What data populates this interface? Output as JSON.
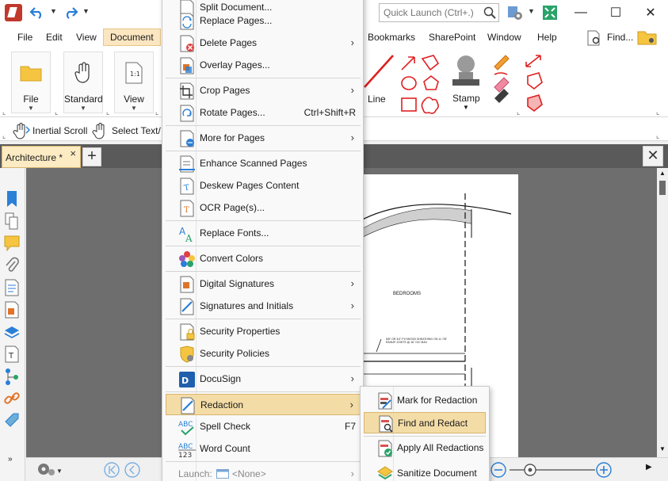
{
  "titlebar": {
    "search_placeholder": "Quick Launch (Ctrl+.)"
  },
  "menubar": {
    "items": [
      "File",
      "Edit",
      "View",
      "Document",
      "Bookmarks",
      "SharePoint",
      "Window",
      "Help"
    ],
    "find_label": "Find..."
  },
  "ribbon": {
    "file_label": "File",
    "standard_label": "Standard",
    "view_label": "View",
    "line_label": "Line",
    "stamp_label": "Stamp"
  },
  "toolbar2": {
    "inertial_scroll": "Inertial Scroll",
    "select_text": "Select Text/"
  },
  "tabs": {
    "document_tab": "Architecture *",
    "close_glyph": "×",
    "add_glyph": "+"
  },
  "page": {
    "label_bedrooms": "BEDROOMS",
    "label_note": "5/8\" OR 3/4\" PLYWOOD SHEATHING ON 11 7/8\" RAINJP JOISTS @ 16\" O/C MAX"
  },
  "document_menu": {
    "top_partial": "Split Document...",
    "items": [
      {
        "label": "Replace Pages...",
        "arrow": false,
        "shortcut": ""
      },
      {
        "label": "Delete Pages",
        "arrow": true,
        "shortcut": ""
      },
      {
        "label": "Overlay Pages...",
        "arrow": false,
        "shortcut": ""
      },
      {
        "label": "Crop Pages",
        "arrow": true,
        "shortcut": ""
      },
      {
        "label": "Rotate Pages...",
        "arrow": false,
        "shortcut": "Ctrl+Shift+R"
      },
      {
        "label": "More for Pages",
        "arrow": true,
        "shortcut": ""
      },
      {
        "label": "Enhance Scanned Pages",
        "arrow": false,
        "shortcut": ""
      },
      {
        "label": "Deskew Pages Content",
        "arrow": false,
        "shortcut": ""
      },
      {
        "label": "OCR Page(s)...",
        "arrow": false,
        "shortcut": ""
      },
      {
        "label": "Replace Fonts...",
        "arrow": false,
        "shortcut": ""
      },
      {
        "label": "Convert Colors",
        "arrow": false,
        "shortcut": ""
      },
      {
        "label": "Digital Signatures",
        "arrow": true,
        "shortcut": ""
      },
      {
        "label": "Signatures and Initials",
        "arrow": true,
        "shortcut": ""
      },
      {
        "label": "Security Properties",
        "arrow": false,
        "shortcut": ""
      },
      {
        "label": "Security Policies",
        "arrow": false,
        "shortcut": ""
      },
      {
        "label": "DocuSign",
        "arrow": true,
        "shortcut": ""
      },
      {
        "label": "Redaction",
        "arrow": true,
        "shortcut": ""
      },
      {
        "label": "Spell Check",
        "arrow": false,
        "shortcut": "F7"
      },
      {
        "label": "Word Count",
        "arrow": false,
        "shortcut": ""
      }
    ],
    "launch_label": "Launch:",
    "launch_value": "<None>"
  },
  "redaction_submenu": {
    "items": [
      {
        "label": "Mark for Redaction"
      },
      {
        "label": "Find and Redact"
      },
      {
        "label": "Apply All Redactions"
      },
      {
        "label": "Sanitize Document"
      }
    ]
  },
  "colors": {
    "highlight": "#f4dca6",
    "accent_blue": "#2a7fd6",
    "redaction_red": "#d9534f"
  }
}
